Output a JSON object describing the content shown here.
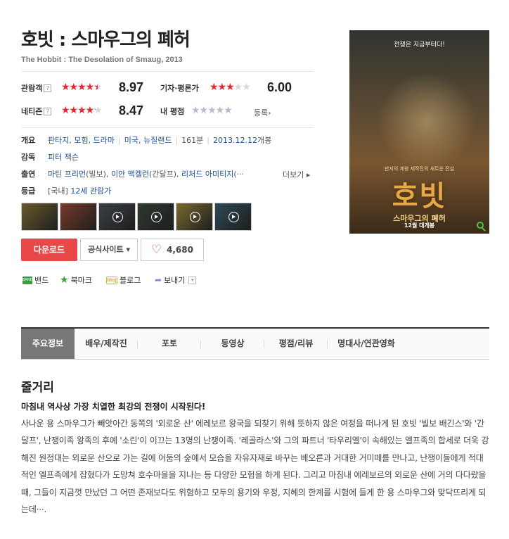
{
  "movie": {
    "title": "호빗 : 스마우그의 폐허",
    "subtitle": "The Hobbit : The Desolation of Smaug, 2013"
  },
  "ratings": {
    "audience": {
      "label": "관람객",
      "help": "?",
      "score": "8.97",
      "fill": 0.897
    },
    "critic": {
      "label": "기자·평론가",
      "score": "6.00",
      "fill": 0.6
    },
    "netizen": {
      "label": "네티즌",
      "help": "?",
      "score": "8.47",
      "fill": 0.847
    },
    "mine": {
      "label": "내 평점",
      "fill": 0,
      "register": "등록›"
    }
  },
  "info": {
    "overview_label": "개요",
    "genres": [
      "판타지",
      "모험",
      "드라마"
    ],
    "countries": [
      "미국",
      "뉴질랜드"
    ],
    "runtime": "161분",
    "release_date": "2013.12.12",
    "release_suffix": "개봉",
    "director_label": "감독",
    "director": "피터 잭슨",
    "cast_label": "출연",
    "cast": [
      {
        "name": "마틴 프리먼",
        "role": "(빌보)"
      },
      {
        "name": "이안 맥켈런",
        "role": "(간달프)"
      },
      {
        "name": "리처드 아미티지",
        "role": "(···"
      }
    ],
    "cast_more": "더보기 ▸",
    "grade_label": "등급",
    "grade_region": "[국내]",
    "grade": "12세 관람가"
  },
  "thumbnails": [
    {
      "kind": "photo",
      "color": "#6a5a2c"
    },
    {
      "kind": "photo",
      "color": "#7a3a2a"
    },
    {
      "kind": "video",
      "color": "#3a3f45"
    },
    {
      "kind": "video",
      "color": "#2e3a30"
    },
    {
      "kind": "video",
      "color": "#7a6a2e"
    },
    {
      "kind": "video",
      "color": "#2f4a55"
    }
  ],
  "actions": {
    "download": "다운로드",
    "official_site": "공식사이트 ▾",
    "likes": "4,680"
  },
  "share": {
    "band_icon": "BAND",
    "band": "밴드",
    "bookmark": "북마크",
    "blog_icon": "blog",
    "blog": "블로그",
    "send": "보내기",
    "dropdown": "▾"
  },
  "poster": {
    "tagline": "전쟁은 지금부터다!",
    "series": "반지의 제왕 제작진의 새로운 전설",
    "title_big": "호빗",
    "title_sub": "스마우그의 폐허",
    "release": "12월 대개봉"
  },
  "tabs": [
    {
      "label": "주요정보",
      "active": true
    },
    {
      "label": "배우/제작진",
      "active": false
    },
    {
      "label": "포토",
      "active": false
    },
    {
      "label": "동영상",
      "active": false
    },
    {
      "label": "평점/리뷰",
      "active": false
    },
    {
      "label": "명대사/연관영화",
      "active": false
    }
  ],
  "synopsis": {
    "section_title": "줄거리",
    "headline": "마침내 역사상 가장 치열한 최강의 전쟁이 시작된다!",
    "body": "사나운 용 스마우그가 빼앗아간 동쪽의 '외로운 산' 에레보르 왕국을 되찾기 위해 뜻하지 않은 여정을 떠나게 된 호빗 '빌보 배긴스'와 '간달프', 난쟁이족 왕족의 후예 '소린'이 이끄는 13명의 난쟁이족. '레골라스'와 그의 파트너 '타우리엘'이 속해있는 엘프족의 합세로 더욱 강해진 원정대는 외로운 산으로 가는 길에 어둠의 숲에서 모습을 자유자재로 바꾸는 베오른과 거대한 거미떼를 만나고, 난쟁이들에게 적대적인 엘프족에게 잡혔다가 도망쳐 호수마을을 지나는 등 다양한 모험을 하게 된다. 그리고 마침내 에레보르의 외로운 산에 거의 다다랐을 때, 그들이 지금껏 만났던 그 어떤 존재보다도 위험하고 모두의 용기와 우정, 지혜의 한계를 시험에 들게 한 용 스마우그와 맞닥뜨리게 되는데···."
  }
}
